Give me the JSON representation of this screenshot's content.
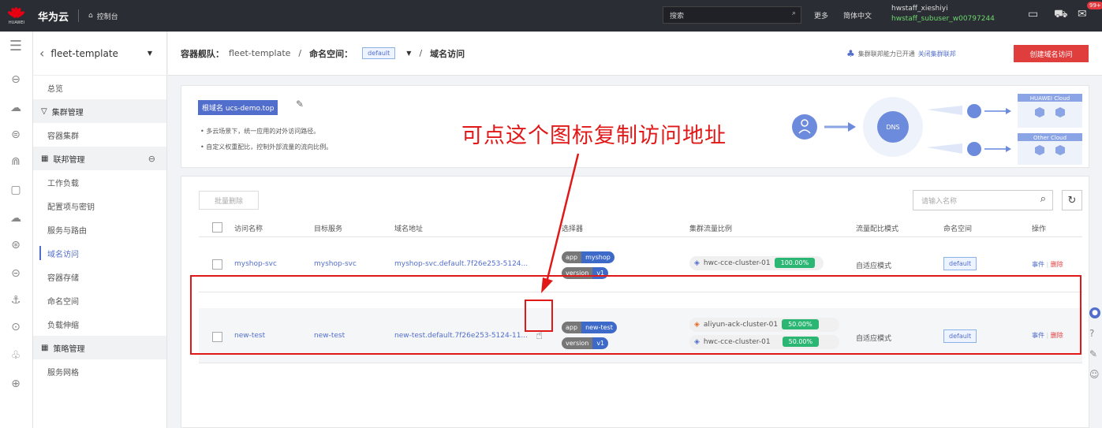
{
  "topbar": {
    "logo_label": "HUAWEI",
    "brand": "华为云",
    "console": "控制台",
    "search_placeholder": "搜索",
    "more": "更多",
    "language": "简体中文",
    "user_line1": "hwstaff_xieshiyi",
    "user_line2": "hwstaff_subuser_w00797244",
    "badge": "99+"
  },
  "sidebar": {
    "title": "fleet-template",
    "items": {
      "overview": "总览",
      "cluster_mgmt": "集群管理",
      "container_cluster": "容器集群",
      "federation_mgmt": "联邦管理",
      "workload": "工作负载",
      "config": "配置项与密钥",
      "service_route": "服务与路由",
      "domain_access": "域名访问",
      "storage": "容器存储",
      "namespace": "命名空间",
      "scaling": "负载伸缩",
      "policy_mgmt": "策略管理",
      "mesh": "服务网格"
    }
  },
  "breadcrumb": {
    "fleet_label": "容器舰队：",
    "fleet_value": "fleet-template",
    "ns_label": "命名空间：",
    "ns_value": "default",
    "page": "域名访问"
  },
  "header_right": {
    "fed_text": "集群联邦能力已开通",
    "fed_link": "关闭集群联邦",
    "create_btn": "创建域名访问"
  },
  "banner": {
    "root_domain": "根域名 ucs-demo.top",
    "bullet1": "多云场景下，统一应用的对外访问路径。",
    "bullet2": "自定义权重配比，控制外部流量的流向比例。",
    "cloud1": "HUAWEI Cloud",
    "cloud2": "Other Cloud",
    "dns": "DNS"
  },
  "annotation": "可点这个图标复制访问地址",
  "table": {
    "bulk_delete": "批量删除",
    "search_placeholder": "请输入名称",
    "headers": [
      "访问名称",
      "目标服务",
      "域名地址",
      "选择器",
      "集群流量比例",
      "流量配比模式",
      "命名空间",
      "操作"
    ],
    "rows": [
      {
        "name": "myshop-svc",
        "service": "myshop-svc",
        "domain": "myshop-svc.default.7f26e253-5124...",
        "sel1_k": "app",
        "sel1_v": "myshop",
        "sel2_k": "version",
        "sel2_v": "v1",
        "cluster1": "hwc-cce-cluster-01",
        "pct1": "100.00%",
        "mode": "自适应模式",
        "ns": "default",
        "op1": "事件",
        "op2": "删除"
      },
      {
        "name": "new-test",
        "service": "new-test",
        "domain": "new-test.default.7f26e253-5124-11...",
        "sel1_k": "app",
        "sel1_v": "new-test",
        "sel2_k": "version",
        "sel2_v": "v1",
        "cluster1": "aliyun-ack-cluster-01",
        "pct1": "50.00%",
        "cluster2": "hwc-cce-cluster-01",
        "pct2": "50.00%",
        "mode": "自适应模式",
        "ns": "default",
        "op1": "事件",
        "op2": "删除"
      }
    ]
  },
  "colors": {
    "accent": "#526ecc",
    "danger": "#e03d3d",
    "success": "#2bb673",
    "topbar": "#2a2d33"
  }
}
